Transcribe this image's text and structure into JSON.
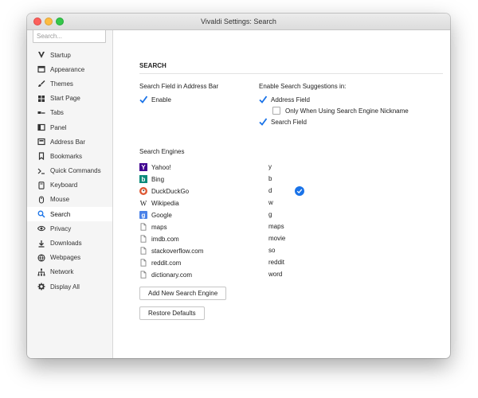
{
  "window": {
    "title": "Vivaldi Settings: Search"
  },
  "sidebar": {
    "search_placeholder": "Search...",
    "items": [
      {
        "label": "Startup",
        "icon": "vivaldi-logo-icon"
      },
      {
        "label": "Appearance",
        "icon": "window-icon"
      },
      {
        "label": "Themes",
        "icon": "brush-icon"
      },
      {
        "label": "Start Page",
        "icon": "grid-icon"
      },
      {
        "label": "Tabs",
        "icon": "tabs-icon"
      },
      {
        "label": "Panel",
        "icon": "panel-icon"
      },
      {
        "label": "Address Bar",
        "icon": "address-bar-icon"
      },
      {
        "label": "Bookmarks",
        "icon": "bookmark-icon"
      },
      {
        "label": "Quick Commands",
        "icon": "command-icon"
      },
      {
        "label": "Keyboard",
        "icon": "keyboard-icon"
      },
      {
        "label": "Mouse",
        "icon": "mouse-icon"
      },
      {
        "label": "Search",
        "icon": "search-icon",
        "active": true
      },
      {
        "label": "Privacy",
        "icon": "eye-icon"
      },
      {
        "label": "Downloads",
        "icon": "download-icon"
      },
      {
        "label": "Webpages",
        "icon": "globe-icon"
      },
      {
        "label": "Network",
        "icon": "network-icon"
      },
      {
        "label": "Display All",
        "icon": "gear-icon"
      }
    ]
  },
  "main": {
    "section_title": "SEARCH",
    "address_bar": {
      "heading": "Search Field in Address Bar",
      "enable_label": "Enable",
      "enable_checked": true
    },
    "suggestions": {
      "heading": "Enable Search Suggestions in:",
      "address_field_label": "Address Field",
      "address_field_checked": true,
      "nickname_only_label": "Only When Using Search Engine Nickname",
      "nickname_only_checked": false,
      "search_field_label": "Search Field",
      "search_field_checked": true
    },
    "engines_heading": "Search Engines",
    "engines": [
      {
        "name": "Yahoo!",
        "key": "y",
        "icon": "yahoo-icon"
      },
      {
        "name": "Bing",
        "key": "b",
        "icon": "bing-icon"
      },
      {
        "name": "DuckDuckGo",
        "key": "d",
        "icon": "duckduckgo-icon",
        "default": true
      },
      {
        "name": "Wikipedia",
        "key": "w",
        "icon": "wikipedia-icon"
      },
      {
        "name": "Google",
        "key": "g",
        "icon": "google-icon"
      },
      {
        "name": "maps",
        "key": "maps",
        "icon": "document-icon"
      },
      {
        "name": "imdb.com",
        "key": "movie",
        "icon": "document-icon"
      },
      {
        "name": "stackoverflow.com",
        "key": "so",
        "icon": "document-icon"
      },
      {
        "name": "reddit.com",
        "key": "reddit",
        "icon": "document-icon"
      },
      {
        "name": "dictionary.com",
        "key": "word",
        "icon": "document-icon"
      }
    ],
    "add_button_label": "Add New Search Engine",
    "restore_button_label": "Restore Defaults"
  },
  "colors": {
    "accent": "#1a73e8",
    "sidebar_bg": "#f5f5f5"
  }
}
